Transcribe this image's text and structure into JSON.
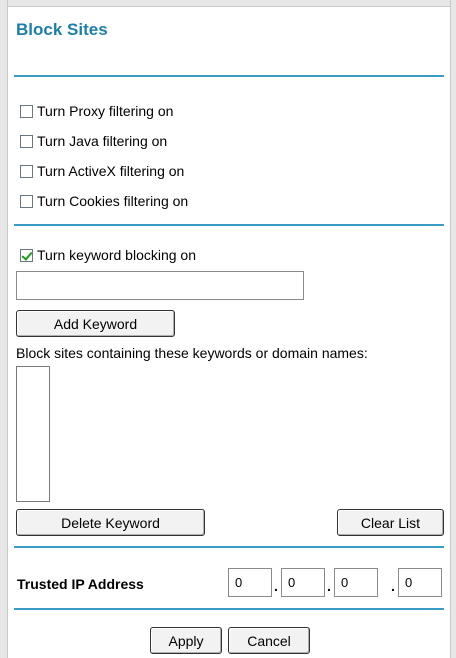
{
  "title": "Block Sites",
  "filters": [
    {
      "label": "Turn Proxy filtering on",
      "checked": false
    },
    {
      "label": "Turn Java filtering on",
      "checked": false
    },
    {
      "label": "Turn ActiveX filtering on",
      "checked": false
    },
    {
      "label": "Turn Cookies filtering on",
      "checked": false
    }
  ],
  "keyword_blocking": {
    "label": "Turn keyword blocking on",
    "checked": true,
    "keyword_value": "",
    "add_button": "Add Keyword",
    "list_label": "Block sites containing these keywords or domain names:",
    "list_items": [],
    "delete_button": "Delete Keyword",
    "clear_button": "Clear List"
  },
  "trusted_ip": {
    "label": "Trusted IP Address",
    "octets": [
      "0",
      "0",
      "0",
      "0"
    ],
    "separator": "."
  },
  "actions": {
    "apply": "Apply",
    "cancel": "Cancel"
  },
  "colors": {
    "title": "#1f7ea8",
    "rule": "#3a9bc4",
    "checkmark": "#1a9a1a"
  }
}
